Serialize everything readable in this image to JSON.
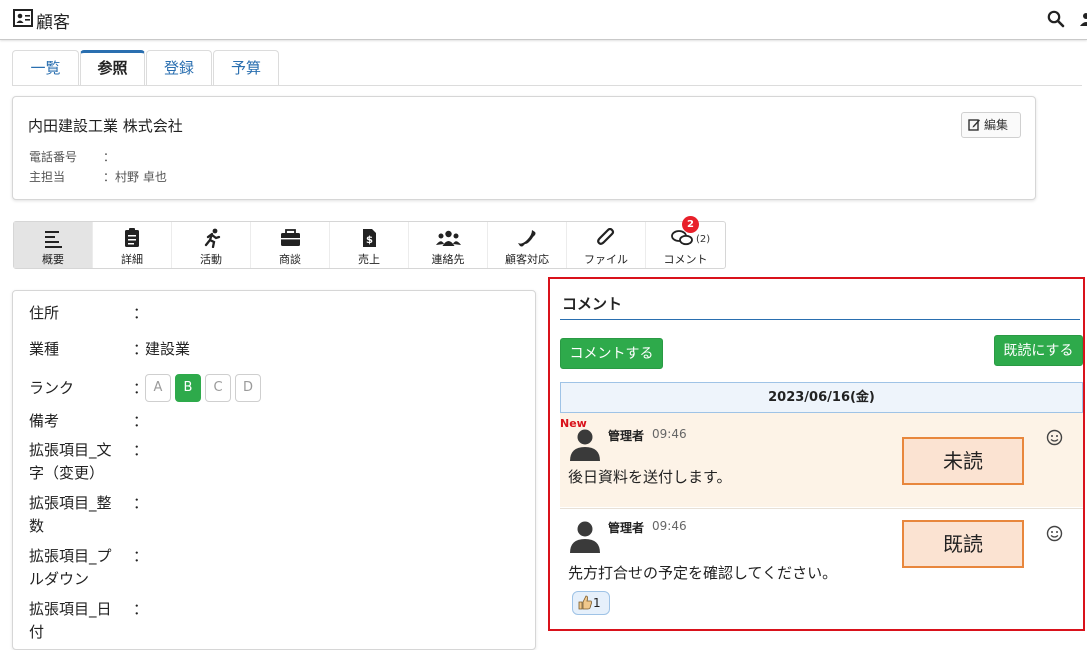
{
  "header": {
    "title": "顧客",
    "title_icon": "contact-card-icon",
    "search_icon": "search-icon",
    "user_icon": "user-icon"
  },
  "tabs": [
    {
      "label": "一覧",
      "active": false
    },
    {
      "label": "参照",
      "active": true
    },
    {
      "label": "登録",
      "active": false
    },
    {
      "label": "予算",
      "active": false
    }
  ],
  "customer": {
    "name": "内田建設工業 株式会社",
    "edit_label": "編集",
    "phone_label": "電話番号",
    "phone_value": "：",
    "owner_label": "主担当",
    "owner_value": "：村野 卓也"
  },
  "icon_tabs": [
    {
      "label": "概要",
      "icon": "list-lines-icon",
      "active": true
    },
    {
      "label": "詳細",
      "icon": "clipboard-icon",
      "active": false
    },
    {
      "label": "活動",
      "icon": "running-person-icon",
      "active": false
    },
    {
      "label": "商談",
      "icon": "briefcase-icon",
      "active": false
    },
    {
      "label": "売上",
      "icon": "invoice-dollar-icon",
      "active": false
    },
    {
      "label": "連絡先",
      "icon": "people-group-icon",
      "active": false
    },
    {
      "label": "顧客対応",
      "icon": "phone-icon",
      "active": false
    },
    {
      "label": "ファイル",
      "icon": "paperclip-icon",
      "active": false
    },
    {
      "label": "コメント",
      "icon": "comments-icon",
      "active": false,
      "badge": "2",
      "count": "(2)"
    }
  ],
  "details": {
    "address_label": "住所",
    "address_value": "",
    "industry_label": "業種",
    "industry_value": "建設業",
    "rank_label": "ランク",
    "ranks": [
      "A",
      "B",
      "C",
      "D"
    ],
    "rank_selected": "B",
    "note_label": "備考",
    "note_value": "",
    "ext_text_label_1": "拡張項目_文",
    "ext_text_label_2": "字（変更）",
    "ext_int_label_1": "拡張項目_整",
    "ext_int_label_2": "数",
    "ext_pull_label_1": "拡張項目_プ",
    "ext_pull_label_2": "ルダウン",
    "ext_date_label_1": "拡張項目_日",
    "ext_date_label_2": "付",
    "separator": "："
  },
  "comments": {
    "title": "コメント",
    "add_button": "コメントする",
    "mark_read_button": "既読にする",
    "date": "2023/06/16(金)",
    "messages": [
      {
        "new_label": "New",
        "author": "管理者",
        "time": "09:46",
        "text": "後日資料を送付します。",
        "stamp": "未読",
        "unread": true
      },
      {
        "author": "管理者",
        "time": "09:46",
        "text": "先方打合せの予定を確認してください。",
        "stamp": "既読",
        "unread": false,
        "reaction_count": "1"
      }
    ],
    "accent_color": "#2eaa4b",
    "highlight_border": "#d9121b"
  }
}
